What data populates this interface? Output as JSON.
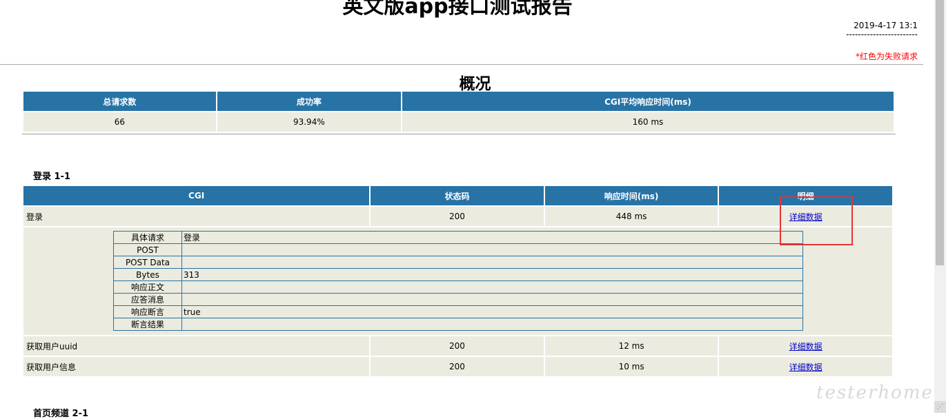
{
  "title": "英文版app接口测试报告",
  "report_time": "2019-4-17 13:1",
  "dash_line": "------------------------",
  "fail_note": "*红色为失败请求",
  "overview": {
    "heading": "概况",
    "headers": [
      "总请求数",
      "成功率",
      "CGI平均响应时间(ms)"
    ],
    "values": [
      "66",
      "93.94%",
      "160 ms"
    ]
  },
  "section1": {
    "label": "登录 1-1",
    "headers": [
      "CGI",
      "状态码",
      "响应时间(ms)",
      "明细"
    ],
    "rows": [
      {
        "name": "登录",
        "status": "200",
        "time": "448 ms",
        "link": "详细数据"
      },
      {
        "name": "获取用户uuid",
        "status": "200",
        "time": "12 ms",
        "link": "详细数据"
      },
      {
        "name": "获取用户信息",
        "status": "200",
        "time": "10 ms",
        "link": "详细数据"
      }
    ],
    "detail": [
      {
        "k": "具体请求",
        "v": "登录"
      },
      {
        "k": "POST",
        "v": ""
      },
      {
        "k": "POST Data",
        "v": ""
      },
      {
        "k": "Bytes",
        "v": "313"
      },
      {
        "k": "响应正文",
        "v": ""
      },
      {
        "k": "应答消息",
        "v": ""
      },
      {
        "k": "响应断言",
        "v": "true"
      },
      {
        "k": "断言结果",
        "v": ""
      }
    ]
  },
  "section2": {
    "label": "首页频道 2-1"
  },
  "watermark": "testerhome.com",
  "colors": {
    "header_bg": "#2773a6",
    "cell_bg": "#ebebdf",
    "fail": "#ff0000",
    "highlight": "#e53333"
  }
}
